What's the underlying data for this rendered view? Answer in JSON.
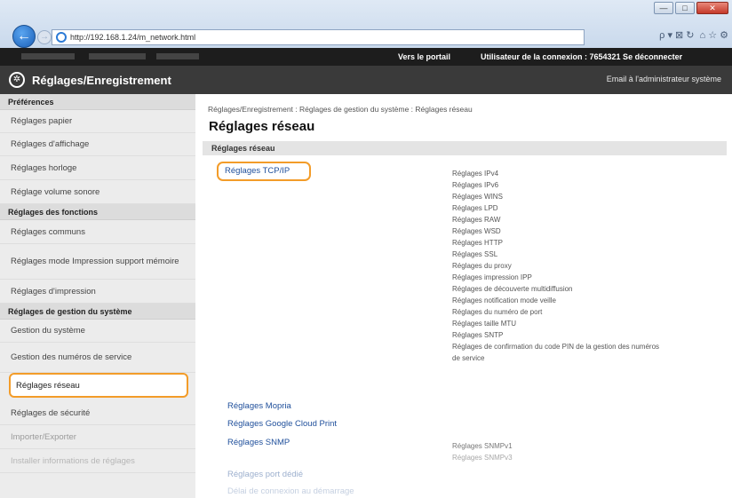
{
  "browser": {
    "url": "http://192.168.1.24/m_network.html",
    "window_buttons": [
      "—",
      "□",
      "✕"
    ],
    "toolbar_icons": [
      "search-icon",
      "refresh-icon",
      "home-icon",
      "star-icon",
      "gear-icon"
    ],
    "search_glyph": "ρ ▾ ⊠ ↻",
    "tool_glyphs": "⌂ ☆ ⚙"
  },
  "topbar": {
    "portal": "Vers le portail",
    "user": "Utilisateur de la connexion :  7654321  Se déconnecter"
  },
  "header": {
    "title": "Réglages/Enregistrement",
    "mail": "Email à l'administrateur système"
  },
  "sidebar": {
    "sections": [
      {
        "title": "Préférences",
        "items": [
          "Réglages papier",
          "Réglages d'affichage",
          "Réglages horloge",
          "Réglage volume sonore"
        ]
      },
      {
        "title": "Réglages des fonctions",
        "items": [
          "Réglages communs",
          "Réglages mode Impression support mémoire",
          "Réglages d'impression"
        ]
      },
      {
        "title": "Réglages de gestion du système",
        "items": [
          "Gestion du système",
          "Gestion des numéros de service",
          "Réglages réseau",
          "Réglages de sécurité",
          "Importer/Exporter",
          "Installer informations de réglages"
        ]
      }
    ]
  },
  "main": {
    "breadcrumb": "Réglages/Enregistrement : Réglages de gestion du système : Réglages réseau",
    "title": "Réglages réseau",
    "section": "Réglages réseau",
    "links": {
      "tcpip": "Réglages TCP/IP",
      "mopria": "Réglages Mopria",
      "gcp": "Réglages Google Cloud Print",
      "snmp": "Réglages SNMP",
      "port": "Réglages port dédié",
      "startup": "Délai de connexion au démarrage"
    },
    "tcpip_items": [
      "Réglages IPv4",
      "Réglages IPv6",
      "Réglages WINS",
      "Réglages LPD",
      "Réglages RAW",
      "Réglages WSD",
      "Réglages HTTP",
      "Réglages SSL",
      "Réglages du proxy",
      "Réglages impression IPP",
      "Réglages de découverte multidiffusion",
      "Réglages notification mode veille",
      "Réglages du numéro de port",
      "Réglages taille MTU",
      "Réglages SNTP",
      "Réglages de confirmation du code PIN de la gestion des numéros",
      "de service"
    ],
    "snmp_items": [
      "Réglages SNMPv1",
      "Réglages SNMPv3"
    ]
  }
}
